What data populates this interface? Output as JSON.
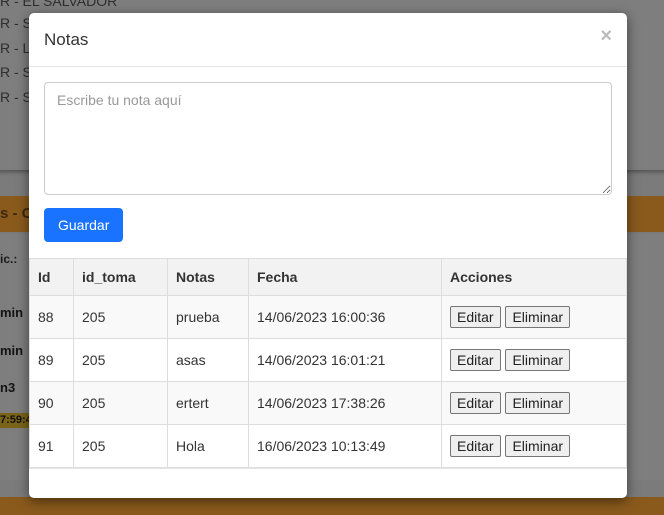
{
  "background": {
    "lines": [
      "R - EL SALVADOR",
      "R - S",
      "R - L",
      "R - S",
      "R - S"
    ],
    "bar_text": "s - O",
    "label": "ic.:",
    "values": [
      "min",
      "min",
      "n3"
    ],
    "tag": "7:59:4"
  },
  "modal": {
    "title": "Notas",
    "close_symbol": "×",
    "textarea_placeholder": "Escribe tu nota aquí",
    "save_label": "Guardar"
  },
  "table": {
    "headers": [
      "Id",
      "id_toma",
      "Notas",
      "Fecha",
      "Acciones"
    ],
    "rows": [
      {
        "id": "88",
        "id_toma": "205",
        "nota": "prueba",
        "fecha": "14/06/2023 16:00:36"
      },
      {
        "id": "89",
        "id_toma": "205",
        "nota": "asas",
        "fecha": "14/06/2023 16:01:21"
      },
      {
        "id": "90",
        "id_toma": "205",
        "nota": "ertert",
        "fecha": "14/06/2023 17:38:26"
      },
      {
        "id": "91",
        "id_toma": "205",
        "nota": "Hola",
        "fecha": "16/06/2023 10:13:49"
      }
    ],
    "edit_label": "Editar",
    "delete_label": "Eliminar"
  },
  "colors": {
    "primary": "#1a73ff",
    "accent_bar": "#8a5a1d"
  }
}
